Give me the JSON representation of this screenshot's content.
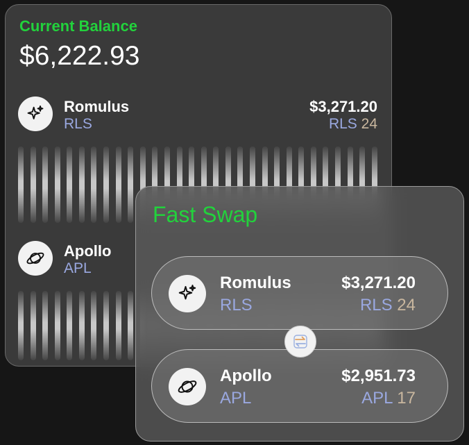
{
  "balance": {
    "label": "Current Balance",
    "value": "$6,222.93"
  },
  "assets": [
    {
      "name": "Romulus",
      "symbol": "RLS",
      "value": "$3,271.20",
      "holding_symbol": "RLS",
      "holding_qty": "24",
      "icon": "sparkles-icon"
    },
    {
      "name": "Apollo",
      "symbol": "APL",
      "icon": "planet-icon"
    }
  ],
  "swap": {
    "title": "Fast Swap",
    "from": {
      "name": "Romulus",
      "symbol": "RLS",
      "value": "$3,271.20",
      "holding_symbol": "RLS",
      "holding_qty": "24",
      "icon": "sparkles-icon"
    },
    "to": {
      "name": "Apollo",
      "symbol": "APL",
      "value": "$2,951.73",
      "holding_symbol": "APL",
      "holding_qty": "17",
      "icon": "planet-icon"
    },
    "swap_icon": "swap-arrows-icon"
  },
  "colors": {
    "accent_green": "#22d23c",
    "symbol_blue": "#9aa8e0",
    "quantity_tan": "#c9b79f",
    "swap_icon_orange": "#e0a060",
    "swap_icon_blue": "#9ab0e0"
  }
}
